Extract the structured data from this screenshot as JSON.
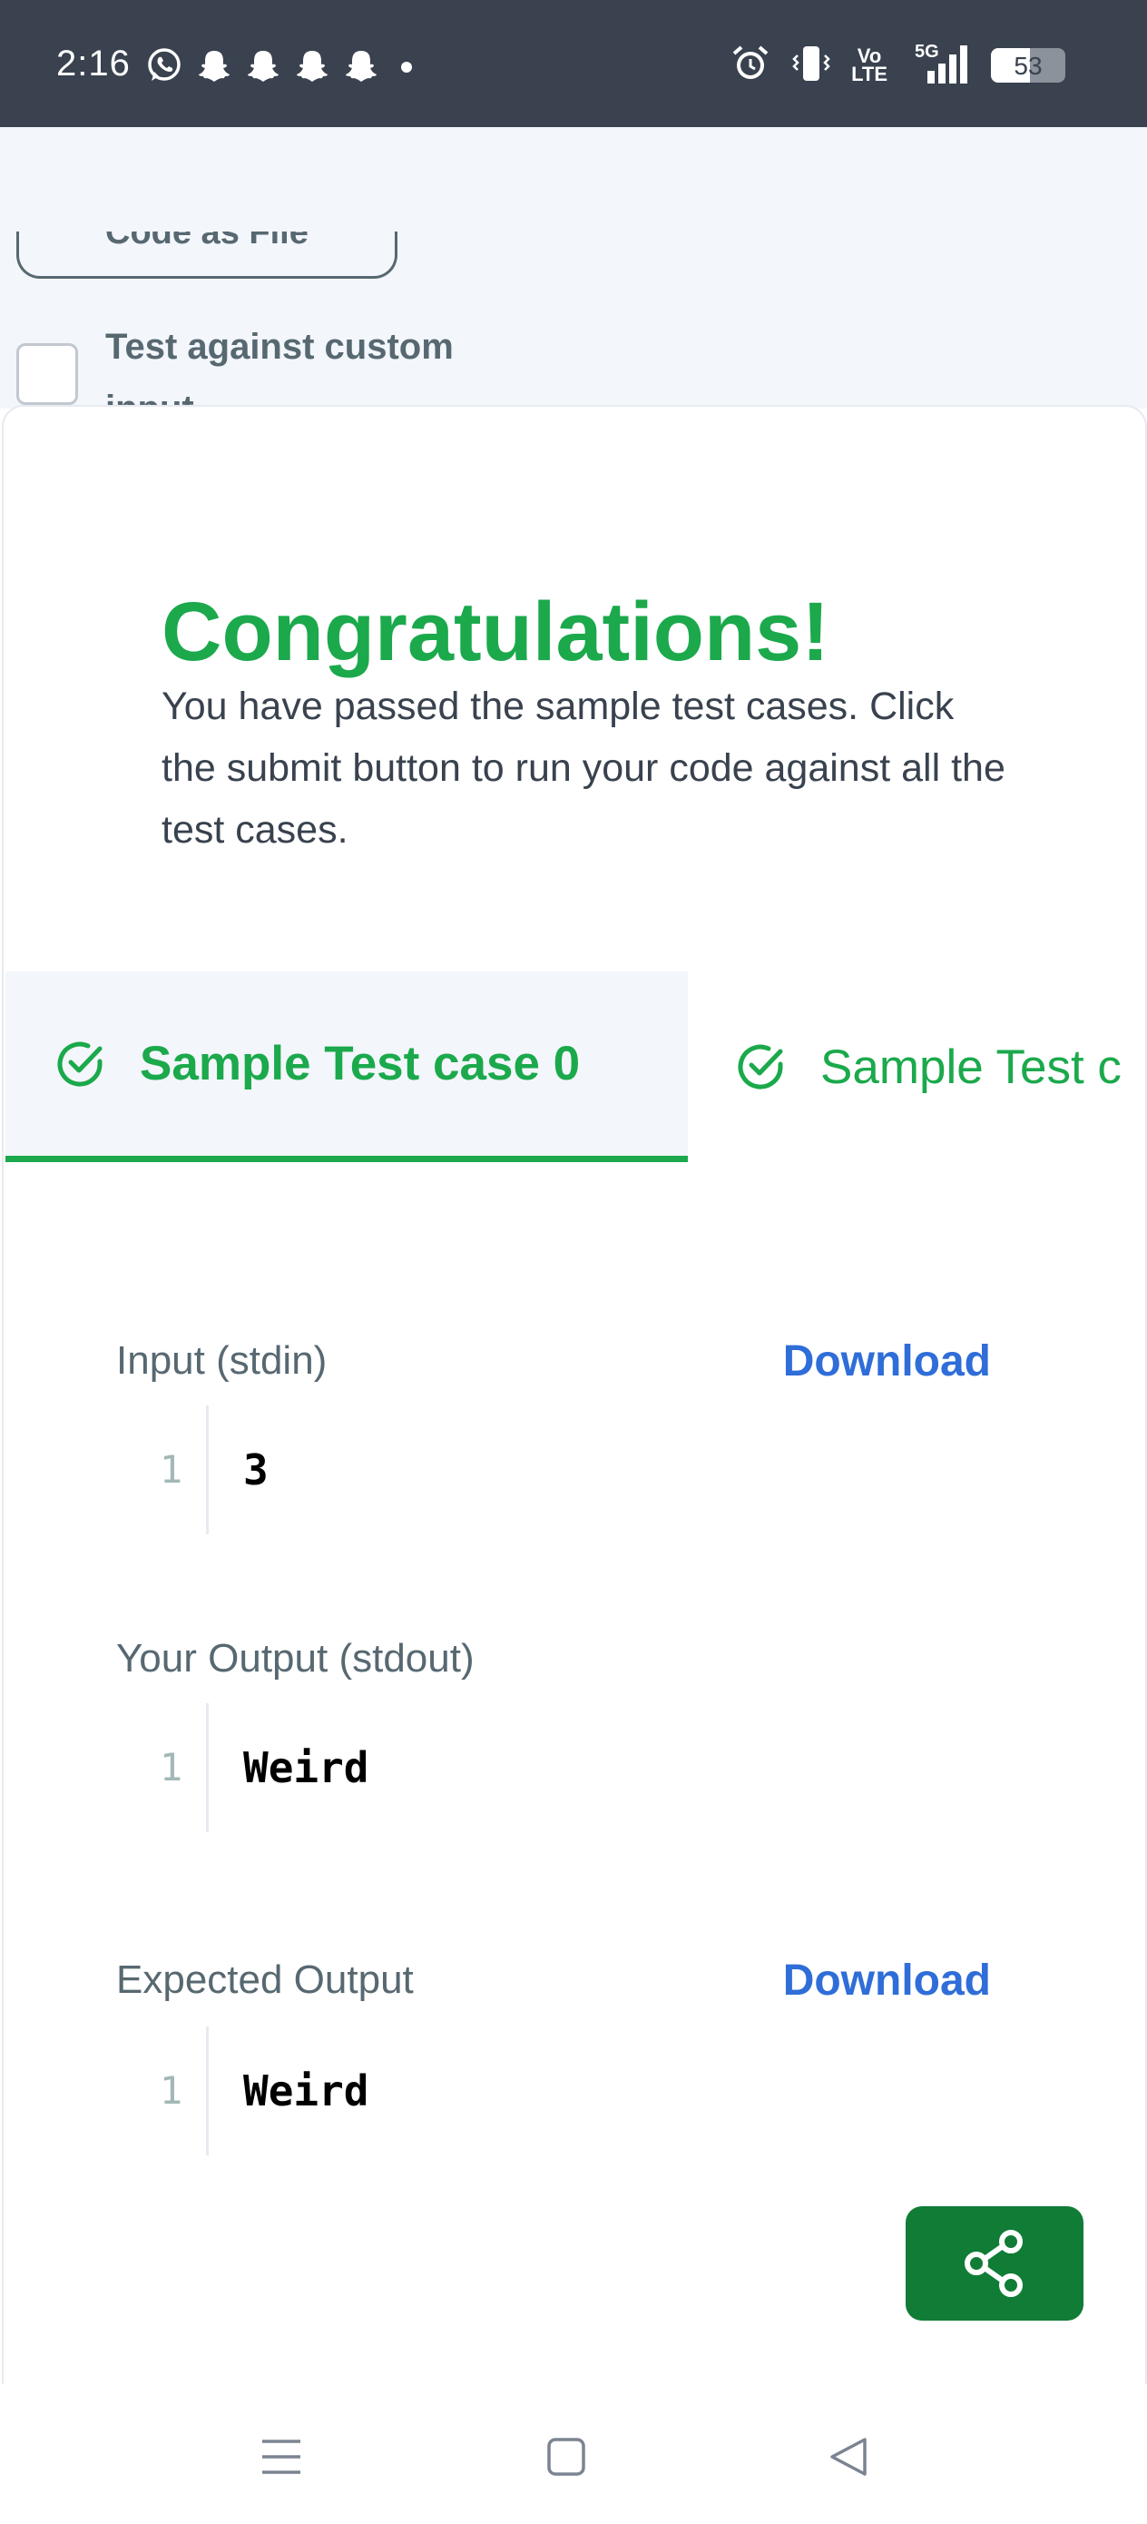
{
  "status_bar": {
    "time": "2:16",
    "icons_left": [
      "whatsapp-icon",
      "snapchat-icon",
      "snapchat-icon",
      "snapchat-icon",
      "snapchat-icon",
      "dot-icon"
    ],
    "icons_right": [
      "alarm-icon",
      "vibrate-icon",
      "volte-icon",
      "5g-signal-icon",
      "battery-icon"
    ],
    "volte_top": "Vo",
    "volte_bottom": "LTE",
    "network": "5G",
    "battery": "53"
  },
  "top": {
    "upload_button_label": "Code as File",
    "custom_input_label": "Test against custom input"
  },
  "result": {
    "title": "Congratulations!",
    "message": "You have passed the sample test cases. Click the submit button to run your code against all the test cases."
  },
  "tabs": [
    {
      "label": "Sample Test case 0",
      "status": "passed",
      "active": true
    },
    {
      "label": "Sample Test c",
      "status": "passed",
      "active": false
    }
  ],
  "test_case": {
    "input": {
      "label": "Input (stdin)",
      "download": "Download",
      "line_number": "1",
      "value": "3"
    },
    "your_output": {
      "label": "Your Output (stdout)",
      "line_number": "1",
      "value": "Weird"
    },
    "expected_output": {
      "label": "Expected Output",
      "download": "Download",
      "line_number": "1",
      "value": "Weird"
    }
  },
  "share_button": {
    "icon": "share-icon"
  },
  "colors": {
    "status_bar": "#39424e",
    "success_green": "#1ba94c",
    "share_green": "#107c36",
    "link_blue": "#2f6dd8",
    "text_gray": "#576871",
    "tab_bg": "#f3f6fb"
  },
  "nav_bar": {
    "items": [
      "menu-icon",
      "home-icon",
      "back-icon"
    ]
  }
}
